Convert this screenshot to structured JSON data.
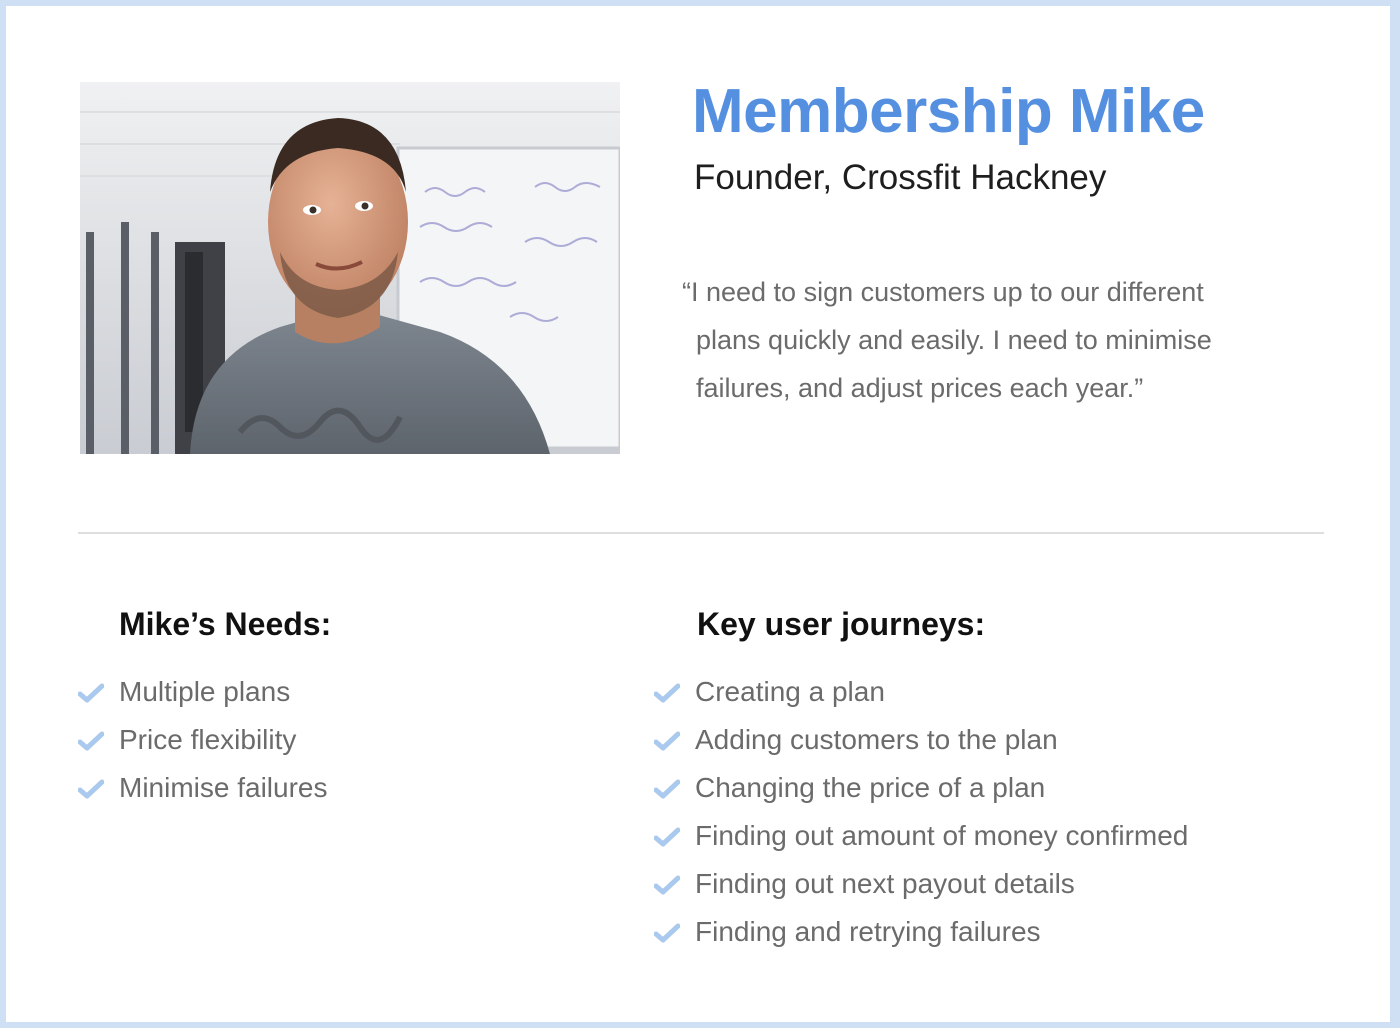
{
  "colors": {
    "accent": "#5590e0",
    "check": "#a9c9ee",
    "body_text": "#6b6b6b",
    "heading_text": "#111111",
    "frame": "#cfe0f5"
  },
  "persona": {
    "name": "Membership Mike",
    "role": "Founder, Crossfit Hackney",
    "quote_lines": [
      "“I need to sign customers up to our different",
      "plans quickly and easily. I need to minimise",
      "failures, and adjust prices each year.”"
    ]
  },
  "needs": {
    "heading": "Mike’s Needs:",
    "items": [
      "Multiple plans",
      "Price flexibility",
      "Minimise failures"
    ]
  },
  "journeys": {
    "heading": "Key user journeys:",
    "items": [
      "Creating a plan",
      "Adding customers to the plan",
      "Changing the price of a plan",
      "Finding out amount of money confirmed",
      "Finding out next payout details",
      "Finding and retrying failures"
    ]
  },
  "icons": {
    "list_marker": "checkmark-icon"
  }
}
